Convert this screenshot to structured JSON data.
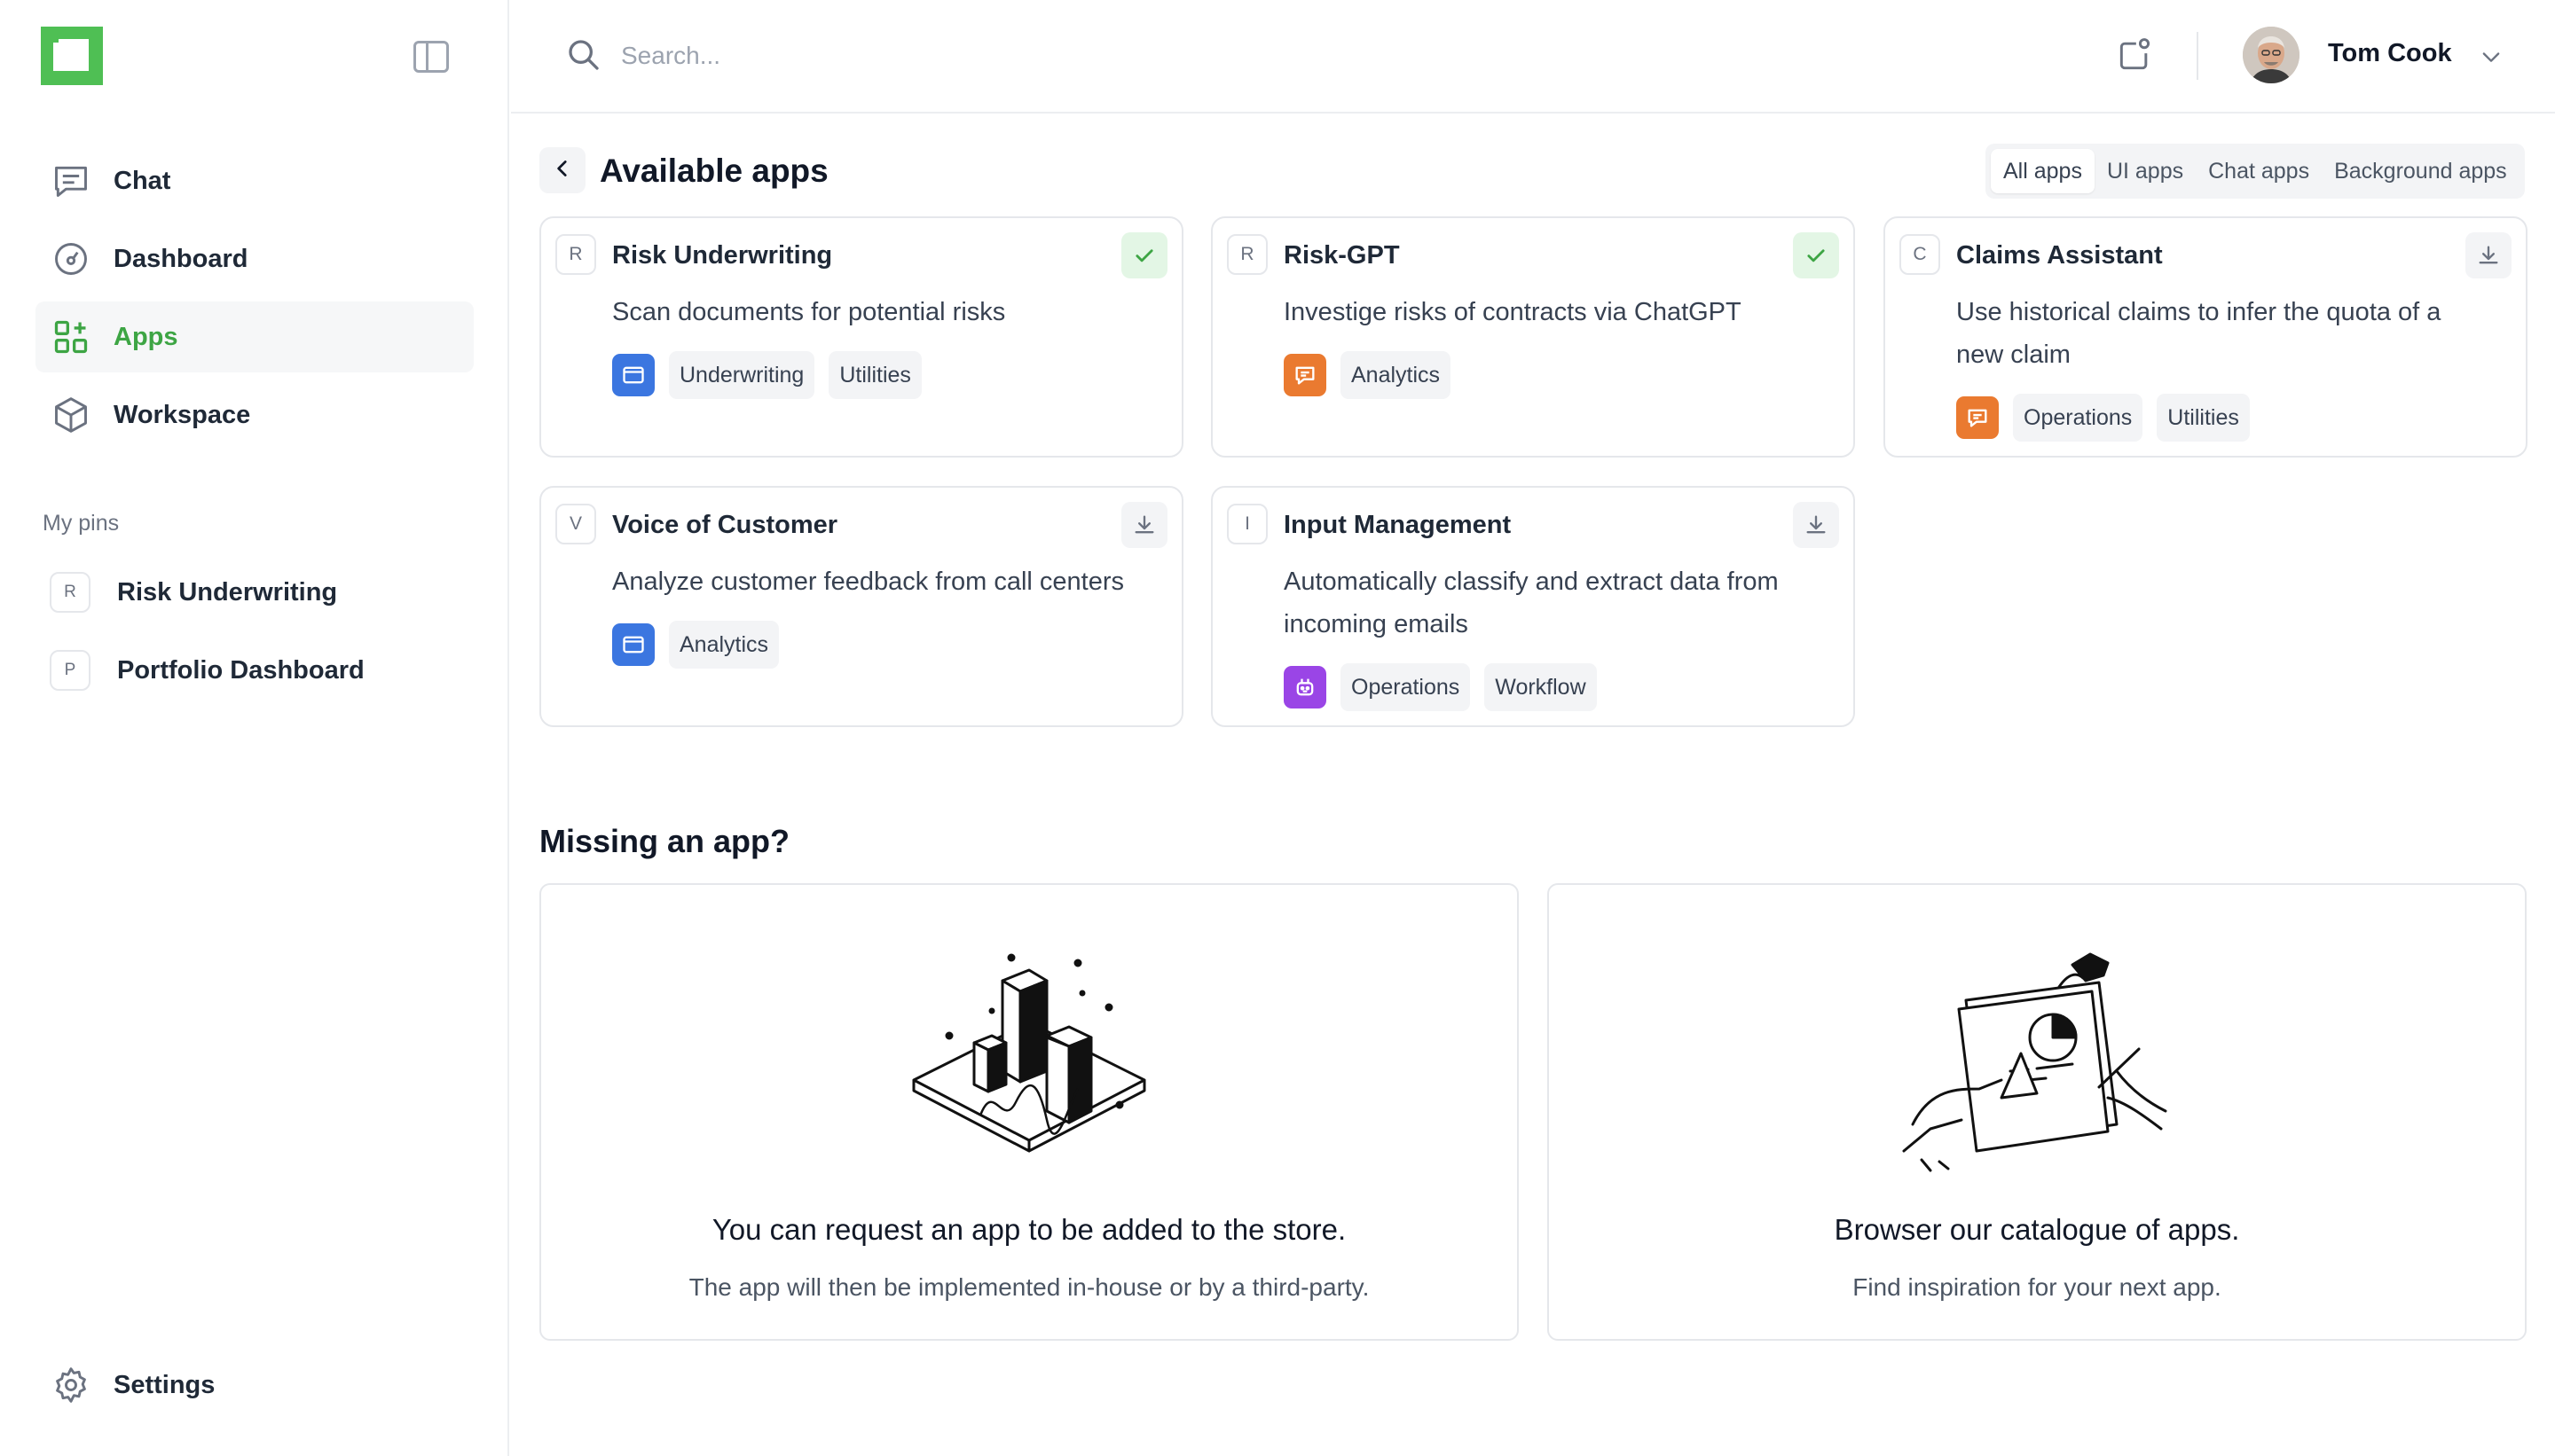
{
  "sidebar": {
    "nav": [
      {
        "label": "Chat",
        "icon": "chat-icon",
        "active": false
      },
      {
        "label": "Dashboard",
        "icon": "gauge-icon",
        "active": false
      },
      {
        "label": "Apps",
        "icon": "apps-grid-icon",
        "active": true
      },
      {
        "label": "Workspace",
        "icon": "cube-icon",
        "active": false
      }
    ],
    "pins_label": "My pins",
    "pins": [
      {
        "letter": "R",
        "label": "Risk Underwriting"
      },
      {
        "letter": "P",
        "label": "Portfolio Dashboard"
      }
    ],
    "settings_label": "Settings"
  },
  "search": {
    "placeholder": "Search..."
  },
  "user": {
    "name": "Tom Cook"
  },
  "main": {
    "title": "Available apps",
    "filters": [
      {
        "label": "All apps",
        "active": true
      },
      {
        "label": "UI apps",
        "active": false
      },
      {
        "label": "Chat apps",
        "active": false
      },
      {
        "label": "Background apps",
        "active": false
      }
    ],
    "apps": [
      {
        "letter": "R",
        "name": "Risk Underwriting",
        "description": "Scan documents for potential risks",
        "status": "installed",
        "app_type": "ui",
        "tags": [
          "Underwriting",
          "Utilities"
        ]
      },
      {
        "letter": "R",
        "name": "Risk-GPT",
        "description": "Investige risks of contracts via ChatGPT",
        "status": "installed",
        "app_type": "chat",
        "tags": [
          "Analytics"
        ]
      },
      {
        "letter": "C",
        "name": "Claims Assistant",
        "description": "Use historical claims to infer the quota of a new claim",
        "status": "download",
        "app_type": "chat",
        "tags": [
          "Operations",
          "Utilities"
        ]
      },
      {
        "letter": "V",
        "name": "Voice of Customer",
        "description": "Analyze customer feedback from call centers",
        "status": "download",
        "app_type": "ui",
        "tags": [
          "Analytics"
        ]
      },
      {
        "letter": "I",
        "name": "Input Management",
        "description": "Automatically classify and extract data from incoming emails",
        "status": "download",
        "app_type": "background",
        "tags": [
          "Operations",
          "Workflow"
        ]
      }
    ],
    "missing_title": "Missing an app?",
    "request_card": {
      "title": "You can request an app to be added to the store.",
      "description": "The app will then be implemented in-house or by a third-party."
    },
    "catalogue_card": {
      "title": "Browser our catalogue of apps.",
      "description": "Find inspiration for your next app."
    }
  },
  "colors": {
    "accent": "#3da544",
    "ui_app": "#3b76e0",
    "chat_app": "#ea7a30",
    "background_app": "#9a45e6"
  }
}
